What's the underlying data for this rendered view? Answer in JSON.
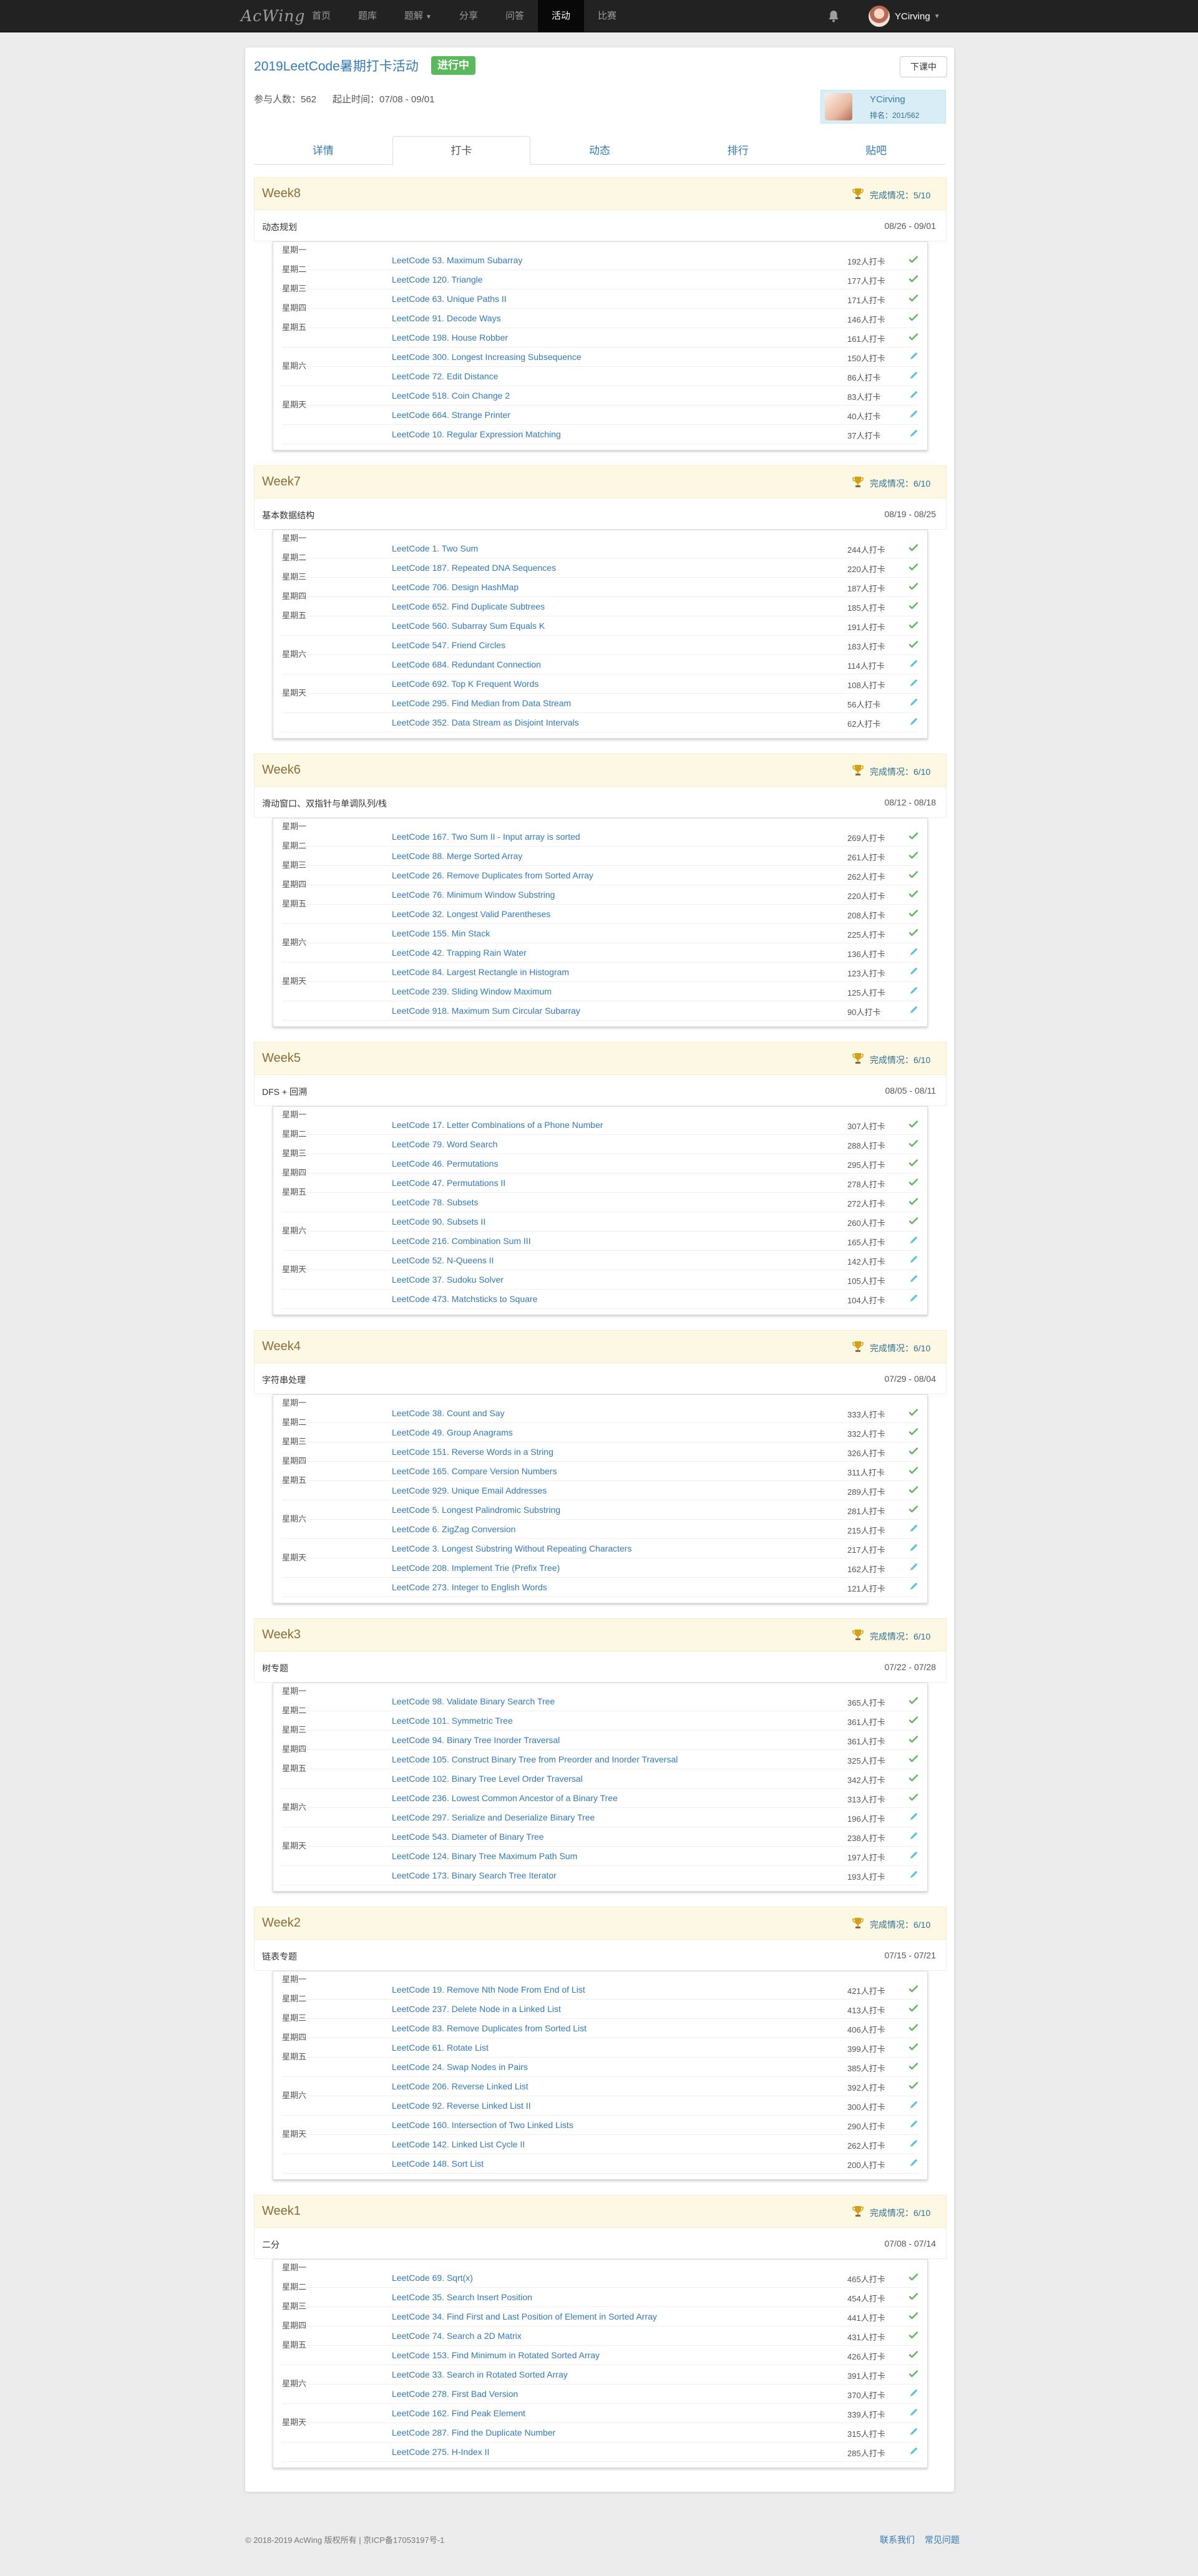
{
  "navbar": {
    "brand": "AcWing",
    "links": [
      {
        "label": "首页",
        "active": false,
        "dropdown": false
      },
      {
        "label": "题库",
        "active": false,
        "dropdown": false
      },
      {
        "label": "题解",
        "active": false,
        "dropdown": true
      },
      {
        "label": "分享",
        "active": false,
        "dropdown": false
      },
      {
        "label": "问答",
        "active": false,
        "dropdown": false
      },
      {
        "label": "活动",
        "active": true,
        "dropdown": false
      },
      {
        "label": "比赛",
        "active": false,
        "dropdown": false
      }
    ],
    "user": "YCirving"
  },
  "activity": {
    "title": "2019LeetCode暑期打卡活动",
    "status": "进行中",
    "signup_button": "下课中",
    "participants": "参与人数：562",
    "period": "起止时间：07/08 - 09/01",
    "me": {
      "name": "YCirving",
      "rank": "排名：201/562"
    }
  },
  "tabs": [
    {
      "label": "详情",
      "active": false
    },
    {
      "label": "打卡",
      "active": true
    },
    {
      "label": "动态",
      "active": false
    },
    {
      "label": "排行",
      "active": false
    },
    {
      "label": "贴吧",
      "active": false
    }
  ],
  "colors": {
    "done": "#5cb85c",
    "todo": "#5bc0de",
    "link": "#337ab7",
    "header_bg": "#fcf8e3"
  },
  "weeks": [
    {
      "title": "Week8",
      "progress": "完成情况：5/10",
      "topic": "动态规划",
      "range": "08/26 - 09/01",
      "problems": [
        {
          "day": "星期一",
          "name": "LeetCode 53. Maximum Subarray",
          "count": "192人打卡",
          "done": true
        },
        {
          "day": "星期二",
          "name": "LeetCode 120. Triangle",
          "count": "177人打卡",
          "done": true
        },
        {
          "day": "星期三",
          "name": "LeetCode 63. Unique Paths II",
          "count": "171人打卡",
          "done": true
        },
        {
          "day": "星期四",
          "name": "LeetCode 91. Decode Ways",
          "count": "146人打卡",
          "done": true
        },
        {
          "day": "星期五",
          "name": "LeetCode 198. House Robber",
          "count": "161人打卡",
          "done": true
        },
        {
          "day": "",
          "name": "LeetCode 300. Longest Increasing Subsequence",
          "count": "150人打卡",
          "done": false
        },
        {
          "day": "星期六",
          "name": "LeetCode 72. Edit Distance",
          "count": "86人打卡",
          "done": false
        },
        {
          "day": "",
          "name": "LeetCode 518. Coin Change 2",
          "count": "83人打卡",
          "done": false
        },
        {
          "day": "星期天",
          "name": "LeetCode 664. Strange Printer",
          "count": "40人打卡",
          "done": false
        },
        {
          "day": "",
          "name": "LeetCode 10. Regular Expression Matching",
          "count": "37人打卡",
          "done": false
        }
      ]
    },
    {
      "title": "Week7",
      "progress": "完成情况：6/10",
      "topic": "基本数据结构",
      "range": "08/19 - 08/25",
      "problems": [
        {
          "day": "星期一",
          "name": "LeetCode 1. Two Sum",
          "count": "244人打卡",
          "done": true
        },
        {
          "day": "星期二",
          "name": "LeetCode 187. Repeated DNA Sequences",
          "count": "220人打卡",
          "done": true
        },
        {
          "day": "星期三",
          "name": "LeetCode 706. Design HashMap",
          "count": "187人打卡",
          "done": true
        },
        {
          "day": "星期四",
          "name": "LeetCode 652. Find Duplicate Subtrees",
          "count": "185人打卡",
          "done": true
        },
        {
          "day": "星期五",
          "name": "LeetCode 560. Subarray Sum Equals K",
          "count": "191人打卡",
          "done": true
        },
        {
          "day": "",
          "name": "LeetCode 547. Friend Circles",
          "count": "183人打卡",
          "done": true
        },
        {
          "day": "星期六",
          "name": "LeetCode 684. Redundant Connection",
          "count": "114人打卡",
          "done": false
        },
        {
          "day": "",
          "name": "LeetCode 692. Top K Frequent Words",
          "count": "108人打卡",
          "done": false
        },
        {
          "day": "星期天",
          "name": "LeetCode 295. Find Median from Data Stream",
          "count": "56人打卡",
          "done": false
        },
        {
          "day": "",
          "name": "LeetCode 352. Data Stream as Disjoint Intervals",
          "count": "62人打卡",
          "done": false
        }
      ]
    },
    {
      "title": "Week6",
      "progress": "完成情况：6/10",
      "topic": "滑动窗口、双指针与单调队列/栈",
      "range": "08/12 - 08/18",
      "problems": [
        {
          "day": "星期一",
          "name": "LeetCode 167. Two Sum II - Input array is sorted",
          "count": "269人打卡",
          "done": true
        },
        {
          "day": "星期二",
          "name": "LeetCode 88. Merge Sorted Array",
          "count": "261人打卡",
          "done": true
        },
        {
          "day": "星期三",
          "name": "LeetCode 26. Remove Duplicates from Sorted Array",
          "count": "262人打卡",
          "done": true
        },
        {
          "day": "星期四",
          "name": "LeetCode 76. Minimum Window Substring",
          "count": "220人打卡",
          "done": true
        },
        {
          "day": "星期五",
          "name": "LeetCode 32. Longest Valid Parentheses",
          "count": "208人打卡",
          "done": true
        },
        {
          "day": "",
          "name": "LeetCode 155. Min Stack",
          "count": "225人打卡",
          "done": true
        },
        {
          "day": "星期六",
          "name": "LeetCode 42. Trapping Rain Water",
          "count": "136人打卡",
          "done": false
        },
        {
          "day": "",
          "name": "LeetCode 84. Largest Rectangle in Histogram",
          "count": "123人打卡",
          "done": false
        },
        {
          "day": "星期天",
          "name": "LeetCode 239. Sliding Window Maximum",
          "count": "125人打卡",
          "done": false
        },
        {
          "day": "",
          "name": "LeetCode 918. Maximum Sum Circular Subarray",
          "count": "90人打卡",
          "done": false
        }
      ]
    },
    {
      "title": "Week5",
      "progress": "完成情况：6/10",
      "topic": "DFS + 回溯",
      "range": "08/05 - 08/11",
      "problems": [
        {
          "day": "星期一",
          "name": "LeetCode 17. Letter Combinations of a Phone Number",
          "count": "307人打卡",
          "done": true
        },
        {
          "day": "星期二",
          "name": "LeetCode 79. Word Search",
          "count": "288人打卡",
          "done": true
        },
        {
          "day": "星期三",
          "name": "LeetCode 46. Permutations",
          "count": "295人打卡",
          "done": true
        },
        {
          "day": "星期四",
          "name": "LeetCode 47. Permutations II",
          "count": "278人打卡",
          "done": true
        },
        {
          "day": "星期五",
          "name": "LeetCode 78. Subsets",
          "count": "272人打卡",
          "done": true
        },
        {
          "day": "",
          "name": "LeetCode 90. Subsets II",
          "count": "260人打卡",
          "done": true
        },
        {
          "day": "星期六",
          "name": "LeetCode 216. Combination Sum III",
          "count": "165人打卡",
          "done": false
        },
        {
          "day": "",
          "name": "LeetCode 52. N-Queens II",
          "count": "142人打卡",
          "done": false
        },
        {
          "day": "星期天",
          "name": "LeetCode 37. Sudoku Solver",
          "count": "105人打卡",
          "done": false
        },
        {
          "day": "",
          "name": "LeetCode 473. Matchsticks to Square",
          "count": "104人打卡",
          "done": false
        }
      ]
    },
    {
      "title": "Week4",
      "progress": "完成情况：6/10",
      "topic": "字符串处理",
      "range": "07/29 - 08/04",
      "problems": [
        {
          "day": "星期一",
          "name": "LeetCode 38. Count and Say",
          "count": "333人打卡",
          "done": true
        },
        {
          "day": "星期二",
          "name": "LeetCode 49. Group Anagrams",
          "count": "332人打卡",
          "done": true
        },
        {
          "day": "星期三",
          "name": "LeetCode 151. Reverse Words in a String",
          "count": "326人打卡",
          "done": true
        },
        {
          "day": "星期四",
          "name": "LeetCode 165. Compare Version Numbers",
          "count": "311人打卡",
          "done": true
        },
        {
          "day": "星期五",
          "name": "LeetCode 929. Unique Email Addresses",
          "count": "289人打卡",
          "done": true
        },
        {
          "day": "",
          "name": "LeetCode 5. Longest Palindromic Substring",
          "count": "281人打卡",
          "done": true
        },
        {
          "day": "星期六",
          "name": "LeetCode 6. ZigZag Conversion",
          "count": "215人打卡",
          "done": false
        },
        {
          "day": "",
          "name": "LeetCode 3. Longest Substring Without Repeating Characters",
          "count": "217人打卡",
          "done": false
        },
        {
          "day": "星期天",
          "name": "LeetCode 208. Implement Trie (Prefix Tree)",
          "count": "162人打卡",
          "done": false
        },
        {
          "day": "",
          "name": "LeetCode 273. Integer to English Words",
          "count": "121人打卡",
          "done": false
        }
      ]
    },
    {
      "title": "Week3",
      "progress": "完成情况：6/10",
      "topic": "树专题",
      "range": "07/22 - 07/28",
      "problems": [
        {
          "day": "星期一",
          "name": "LeetCode 98. Validate Binary Search Tree",
          "count": "365人打卡",
          "done": true
        },
        {
          "day": "星期二",
          "name": "LeetCode 101. Symmetric Tree",
          "count": "361人打卡",
          "done": true
        },
        {
          "day": "星期三",
          "name": "LeetCode 94. Binary Tree Inorder Traversal",
          "count": "361人打卡",
          "done": true
        },
        {
          "day": "星期四",
          "name": "LeetCode 105. Construct Binary Tree from Preorder and Inorder Traversal",
          "count": "325人打卡",
          "done": true
        },
        {
          "day": "星期五",
          "name": "LeetCode 102. Binary Tree Level Order Traversal",
          "count": "342人打卡",
          "done": true
        },
        {
          "day": "",
          "name": "LeetCode 236. Lowest Common Ancestor of a Binary Tree",
          "count": "313人打卡",
          "done": true
        },
        {
          "day": "星期六",
          "name": "LeetCode 297. Serialize and Deserialize Binary Tree",
          "count": "196人打卡",
          "done": false
        },
        {
          "day": "",
          "name": "LeetCode 543. Diameter of Binary Tree",
          "count": "238人打卡",
          "done": false
        },
        {
          "day": "星期天",
          "name": "LeetCode 124. Binary Tree Maximum Path Sum",
          "count": "197人打卡",
          "done": false
        },
        {
          "day": "",
          "name": "LeetCode 173. Binary Search Tree Iterator",
          "count": "193人打卡",
          "done": false
        }
      ]
    },
    {
      "title": "Week2",
      "progress": "完成情况：6/10",
      "topic": "链表专题",
      "range": "07/15 - 07/21",
      "problems": [
        {
          "day": "星期一",
          "name": "LeetCode 19. Remove Nth Node From End of List",
          "count": "421人打卡",
          "done": true
        },
        {
          "day": "星期二",
          "name": "LeetCode 237. Delete Node in a Linked List",
          "count": "413人打卡",
          "done": true
        },
        {
          "day": "星期三",
          "name": "LeetCode 83. Remove Duplicates from Sorted List",
          "count": "406人打卡",
          "done": true
        },
        {
          "day": "星期四",
          "name": "LeetCode 61. Rotate List",
          "count": "399人打卡",
          "done": true
        },
        {
          "day": "星期五",
          "name": "LeetCode 24. Swap Nodes in Pairs",
          "count": "385人打卡",
          "done": true
        },
        {
          "day": "",
          "name": "LeetCode 206. Reverse Linked List",
          "count": "392人打卡",
          "done": true
        },
        {
          "day": "星期六",
          "name": "LeetCode 92. Reverse Linked List II",
          "count": "300人打卡",
          "done": false
        },
        {
          "day": "",
          "name": "LeetCode 160. Intersection of Two Linked Lists",
          "count": "290人打卡",
          "done": false
        },
        {
          "day": "星期天",
          "name": "LeetCode 142. Linked List Cycle II",
          "count": "262人打卡",
          "done": false
        },
        {
          "day": "",
          "name": "LeetCode 148. Sort List",
          "count": "200人打卡",
          "done": false
        }
      ]
    },
    {
      "title": "Week1",
      "progress": "完成情况：6/10",
      "topic": "二分",
      "range": "07/08 - 07/14",
      "problems": [
        {
          "day": "星期一",
          "name": "LeetCode 69. Sqrt(x)",
          "count": "465人打卡",
          "done": true
        },
        {
          "day": "星期二",
          "name": "LeetCode 35. Search Insert Position",
          "count": "454人打卡",
          "done": true
        },
        {
          "day": "星期三",
          "name": "LeetCode 34. Find First and Last Position of Element in Sorted Array",
          "count": "441人打卡",
          "done": true
        },
        {
          "day": "星期四",
          "name": "LeetCode 74. Search a 2D Matrix",
          "count": "431人打卡",
          "done": true
        },
        {
          "day": "星期五",
          "name": "LeetCode 153. Find Minimum in Rotated Sorted Array",
          "count": "426人打卡",
          "done": true
        },
        {
          "day": "",
          "name": "LeetCode 33. Search in Rotated Sorted Array",
          "count": "391人打卡",
          "done": true
        },
        {
          "day": "星期六",
          "name": "LeetCode 278. First Bad Version",
          "count": "370人打卡",
          "done": false
        },
        {
          "day": "",
          "name": "LeetCode 162. Find Peak Element",
          "count": "339人打卡",
          "done": false
        },
        {
          "day": "星期天",
          "name": "LeetCode 287. Find the Duplicate Number",
          "count": "315人打卡",
          "done": false
        },
        {
          "day": "",
          "name": "LeetCode 275. H-Index II",
          "count": "285人打卡",
          "done": false
        }
      ]
    }
  ],
  "footer": {
    "copyright": "© 2018-2019 AcWing 版权所有  |  京ICP备17053197号-1",
    "links": [
      "联系我们",
      "常见问题"
    ]
  }
}
